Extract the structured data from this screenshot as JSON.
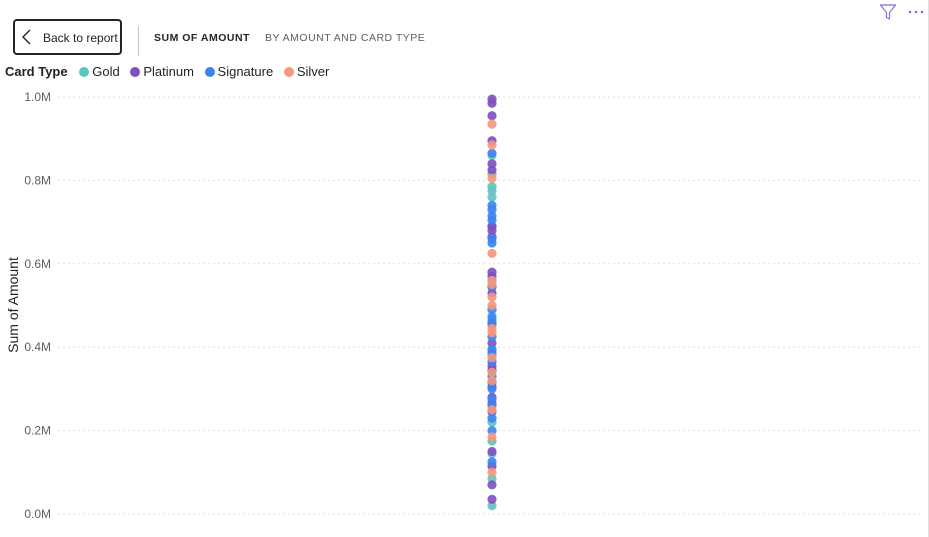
{
  "header": {
    "back_label": "Back to report",
    "tabs": [
      "SUM OF AMOUNT",
      "BY AMOUNT AND CARD TYPE"
    ]
  },
  "legend": {
    "title": "Card Type",
    "items": [
      {
        "name": "Gold",
        "color": "#5FC3BE"
      },
      {
        "name": "Platinum",
        "color": "#7E4FC0"
      },
      {
        "name": "Signature",
        "color": "#3B84F0"
      },
      {
        "name": "Silver",
        "color": "#F4977C"
      }
    ]
  },
  "icons": {
    "filter": "filter-icon",
    "more": "more-options-icon",
    "back": "chevron-left-icon"
  },
  "chart_data": {
    "type": "scatter",
    "title": "",
    "xlabel": "",
    "ylabel": "Sum of Amount",
    "ylim": [
      0,
      1000000
    ],
    "yticks": [
      "0.0M",
      "0.2M",
      "0.4M",
      "0.6M",
      "0.8M",
      "1.0M"
    ],
    "grid": true,
    "legend_position": "top-left",
    "series": [
      {
        "name": "Gold",
        "values": [
          0.02,
          0.085,
          0.145,
          0.175,
          0.22,
          0.39,
          0.475,
          0.69,
          0.76,
          0.775,
          0.785,
          0.815,
          0.86
        ]
      },
      {
        "name": "Platinum",
        "values": [
          0.035,
          0.07,
          0.115,
          0.15,
          0.245,
          0.265,
          0.28,
          0.305,
          0.345,
          0.355,
          0.41,
          0.455,
          0.53,
          0.545,
          0.57,
          0.58,
          0.665,
          0.68,
          0.69,
          0.825,
          0.84,
          0.895,
          0.955,
          0.985,
          0.995
        ]
      },
      {
        "name": "Signature",
        "values": [
          0.125,
          0.2,
          0.23,
          0.26,
          0.275,
          0.3,
          0.315,
          0.33,
          0.365,
          0.385,
          0.395,
          0.425,
          0.46,
          0.47,
          0.49,
          0.545,
          0.56,
          0.65,
          0.66,
          0.705,
          0.715,
          0.73,
          0.74,
          0.865
        ]
      },
      {
        "name": "Silver",
        "values": [
          0.1,
          0.185,
          0.25,
          0.32,
          0.34,
          0.375,
          0.435,
          0.445,
          0.5,
          0.52,
          0.55,
          0.56,
          0.625,
          0.805,
          0.885,
          0.935
        ]
      }
    ]
  }
}
